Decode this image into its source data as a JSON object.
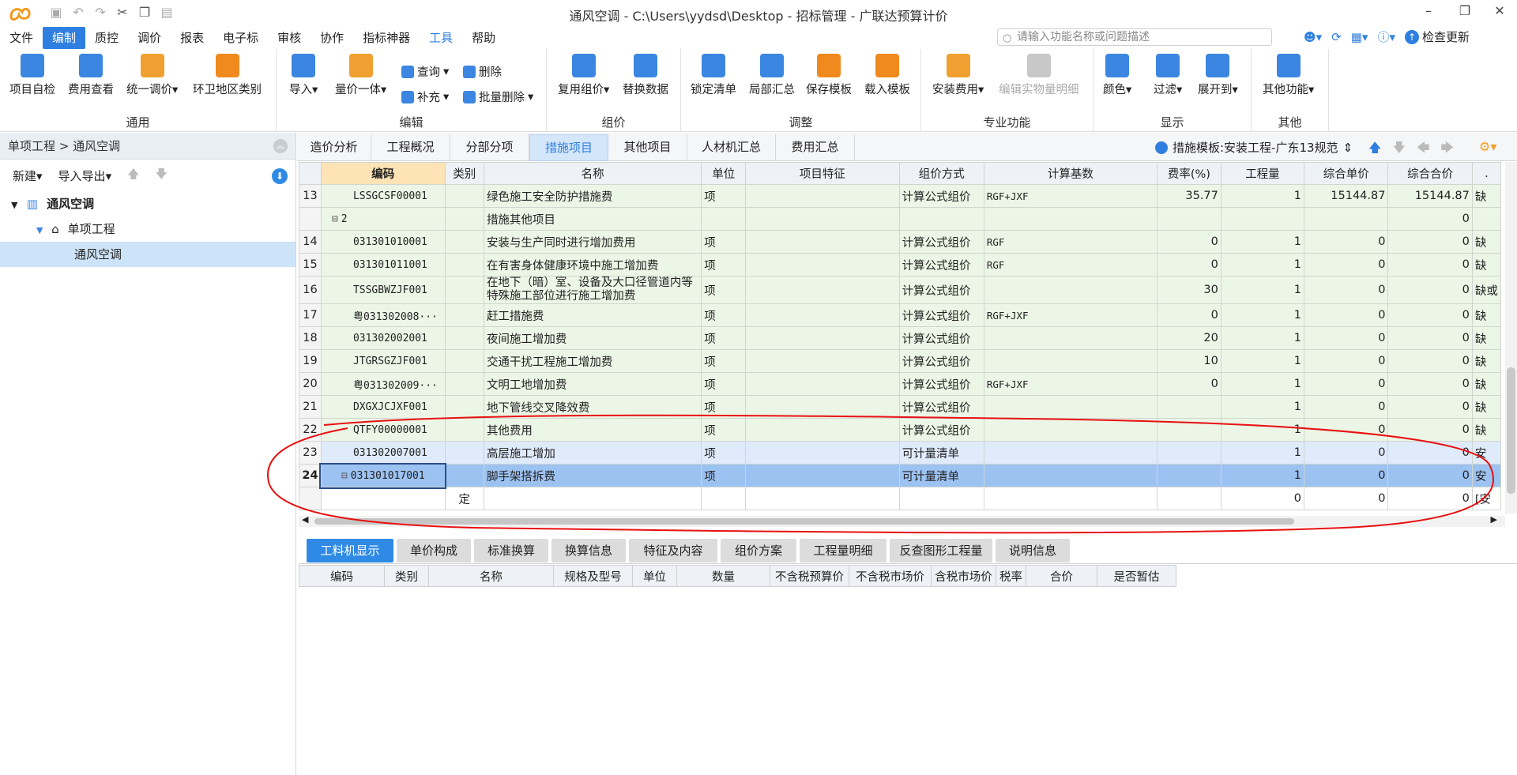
{
  "window": {
    "title": "通风空调 - C:\\Users\\yydsd\\Desktop - 招标管理 - 广联达预算计价"
  },
  "menu": [
    "文件",
    "编制",
    "质控",
    "调价",
    "报表",
    "电子标",
    "审核",
    "协作",
    "指标神器",
    "工具",
    "帮助"
  ],
  "search": {
    "placeholder": "请输入功能名称或问题描述"
  },
  "topright": {
    "update": "检查更新"
  },
  "ribbon": {
    "groups": [
      "通用",
      "编辑",
      "组价",
      "调整",
      "专业功能",
      "显示",
      "其他"
    ],
    "general": [
      "项目自检",
      "费用查看",
      "统一调价",
      "环卫地区类别"
    ],
    "edit_big": [
      "导入",
      "量价一体"
    ],
    "edit_small": [
      "查询",
      "补充",
      "删除",
      "批量删除"
    ],
    "pricing": [
      "复用组价",
      "替换数据"
    ],
    "adjust": [
      "锁定清单",
      "局部汇总",
      "保存模板",
      "载入模板"
    ],
    "special": [
      "安装费用",
      "编辑实物量明细"
    ],
    "display": [
      "颜色",
      "过滤",
      "展开到"
    ],
    "other": [
      "其他功能"
    ]
  },
  "left": {
    "breadcrumb": "单项工程 > 通风空调",
    "new": "新建",
    "import_export": "导入导出",
    "tree": [
      "通风空调",
      "单项工程",
      "通风空调"
    ]
  },
  "tabs": [
    "造价分析",
    "工程概况",
    "分部分项",
    "措施项目",
    "其他项目",
    "人材机汇总",
    "费用汇总"
  ],
  "template": "措施模板:安装工程-广东13规范",
  "grid": {
    "headers": [
      "编码",
      "类别",
      "名称",
      "单位",
      "项目特征",
      "组价方式",
      "计算基数",
      "费率(%)",
      "工程量",
      "综合单价",
      "综合合价"
    ],
    "rows": [
      {
        "no": "13",
        "code": "LSSGCSF00001",
        "type": "",
        "name": "绿色施工安全防护措施费",
        "unit": "项",
        "feature": "",
        "method": "计算公式组价",
        "base": "RGF+JXF",
        "rate": "35.77",
        "qty": "1",
        "price": "15144.87",
        "total": "15144.87",
        "extra": "缺"
      },
      {
        "no": "",
        "code": "2",
        "type": "",
        "name": "措施其他项目",
        "unit": "",
        "feature": "",
        "method": "",
        "base": "",
        "rate": "",
        "qty": "",
        "price": "",
        "total": "0",
        "extra": ""
      },
      {
        "no": "14",
        "code": "031301010001",
        "type": "",
        "name": "安装与生产同时进行增加费用",
        "unit": "项",
        "feature": "",
        "method": "计算公式组价",
        "base": "RGF",
        "rate": "0",
        "qty": "1",
        "price": "0",
        "total": "0",
        "extra": "缺"
      },
      {
        "no": "15",
        "code": "031301011001",
        "type": "",
        "name": "在有害身体健康环境中施工增加费",
        "unit": "项",
        "feature": "",
        "method": "计算公式组价",
        "base": "RGF",
        "rate": "0",
        "qty": "1",
        "price": "0",
        "total": "0",
        "extra": "缺"
      },
      {
        "no": "16",
        "code": "TSSGBWZJF001",
        "type": "",
        "name": "在地下（暗）室、设备及大口径管道内等特殊施工部位进行施工增加费",
        "unit": "项",
        "feature": "",
        "method": "计算公式组价",
        "base": "",
        "rate": "30",
        "qty": "1",
        "price": "0",
        "total": "0",
        "extra": "缺或"
      },
      {
        "no": "17",
        "code": "粤031302008···",
        "type": "",
        "name": "赶工措施费",
        "unit": "项",
        "feature": "",
        "method": "计算公式组价",
        "base": "RGF+JXF",
        "rate": "0",
        "qty": "1",
        "price": "0",
        "total": "0",
        "extra": "缺"
      },
      {
        "no": "18",
        "code": "031302002001",
        "type": "",
        "name": "夜间施工增加费",
        "unit": "项",
        "feature": "",
        "method": "计算公式组价",
        "base": "",
        "rate": "20",
        "qty": "1",
        "price": "0",
        "total": "0",
        "extra": "缺"
      },
      {
        "no": "19",
        "code": "JTGRSGZJF001",
        "type": "",
        "name": "交通干扰工程施工增加费",
        "unit": "项",
        "feature": "",
        "method": "计算公式组价",
        "base": "",
        "rate": "10",
        "qty": "1",
        "price": "0",
        "total": "0",
        "extra": "缺"
      },
      {
        "no": "20",
        "code": "粤031302009···",
        "type": "",
        "name": "文明工地增加费",
        "unit": "项",
        "feature": "",
        "method": "计算公式组价",
        "base": "RGF+JXF",
        "rate": "0",
        "qty": "1",
        "price": "0",
        "total": "0",
        "extra": "缺"
      },
      {
        "no": "21",
        "code": "DXGXJCJXF001",
        "type": "",
        "name": "地下管线交叉降效费",
        "unit": "项",
        "feature": "",
        "method": "计算公式组价",
        "base": "",
        "rate": "",
        "qty": "1",
        "price": "0",
        "total": "0",
        "extra": "缺"
      },
      {
        "no": "22",
        "code": "QTFY00000001",
        "type": "",
        "name": "其他费用",
        "unit": "项",
        "feature": "",
        "method": "计算公式组价",
        "base": "",
        "rate": "",
        "qty": "1",
        "price": "0",
        "total": "0",
        "extra": "缺"
      },
      {
        "no": "23",
        "code": "031302007001",
        "type": "",
        "name": "高层施工增加",
        "unit": "项",
        "feature": "",
        "method": "可计量清单",
        "base": "",
        "rate": "",
        "qty": "1",
        "price": "0",
        "total": "0",
        "extra": "安"
      },
      {
        "no": "24",
        "code": "031301017001",
        "type": "",
        "name": "脚手架搭拆费",
        "unit": "项",
        "feature": "",
        "method": "可计量清单",
        "base": "",
        "rate": "",
        "qty": "1",
        "price": "0",
        "total": "0",
        "extra": "安"
      },
      {
        "no": "",
        "code": "",
        "type": "定",
        "name": "",
        "unit": "",
        "feature": "",
        "method": "",
        "base": "",
        "rate": "",
        "qty": "0",
        "price": "0",
        "total": "0",
        "extra": "[安"
      }
    ]
  },
  "bottom_tabs": [
    "工料机显示",
    "单价构成",
    "标准换算",
    "换算信息",
    "特征及内容",
    "组价方案",
    "工程量明细",
    "反查图形工程量",
    "说明信息"
  ],
  "sub_headers": [
    "编码",
    "类别",
    "名称",
    "规格及型号",
    "单位",
    "数量",
    "不含税预算价",
    "不含税市场价",
    "含税市场价",
    "税率",
    "合价",
    "是否暂估"
  ]
}
